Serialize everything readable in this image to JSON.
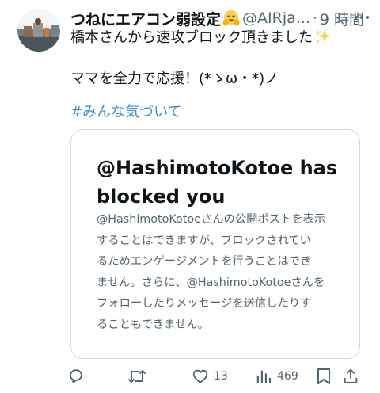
{
  "post": {
    "display_name": "つねにエアコン弱設定",
    "handle": "@AIRja...",
    "separator": "·",
    "time": "9 時間",
    "text_line1": "橋本さんから速攻ブロック頂きました",
    "text_line2": "ママを全力で応援！(*ゝω・*)ノ",
    "hashtag": "#みんな気づいて",
    "icons": {
      "name_emoji": "smiling-face-with-open-hands-icon",
      "text_emoji": "sparkles-icon",
      "more": "more-icon"
    }
  },
  "card": {
    "title_line1": "@HashimotoKotoe has",
    "title_line2": "blocked you",
    "body_lines": [
      "@HashimotoKotoeさんの公開ポストを表示",
      "することはできますが、ブロックされてい",
      "るためエンゲージメントを行うことはでき",
      "ません。さらに、@HashimotoKotoeさんを",
      "フォローしたりメッセージを送信したりす",
      "ることもできません。"
    ]
  },
  "actions": {
    "reply_icon": "reply-icon",
    "repost_icon": "repost-icon",
    "like_icon": "like-icon",
    "like_count": "13",
    "views_icon": "views-icon",
    "views_count": "469",
    "bookmark_icon": "bookmark-icon",
    "share_icon": "share-icon"
  },
  "colors": {
    "text": "#0f1419",
    "secondary": "#536471",
    "hashtag": "#3d8dcc",
    "border": "#cfd9de"
  }
}
